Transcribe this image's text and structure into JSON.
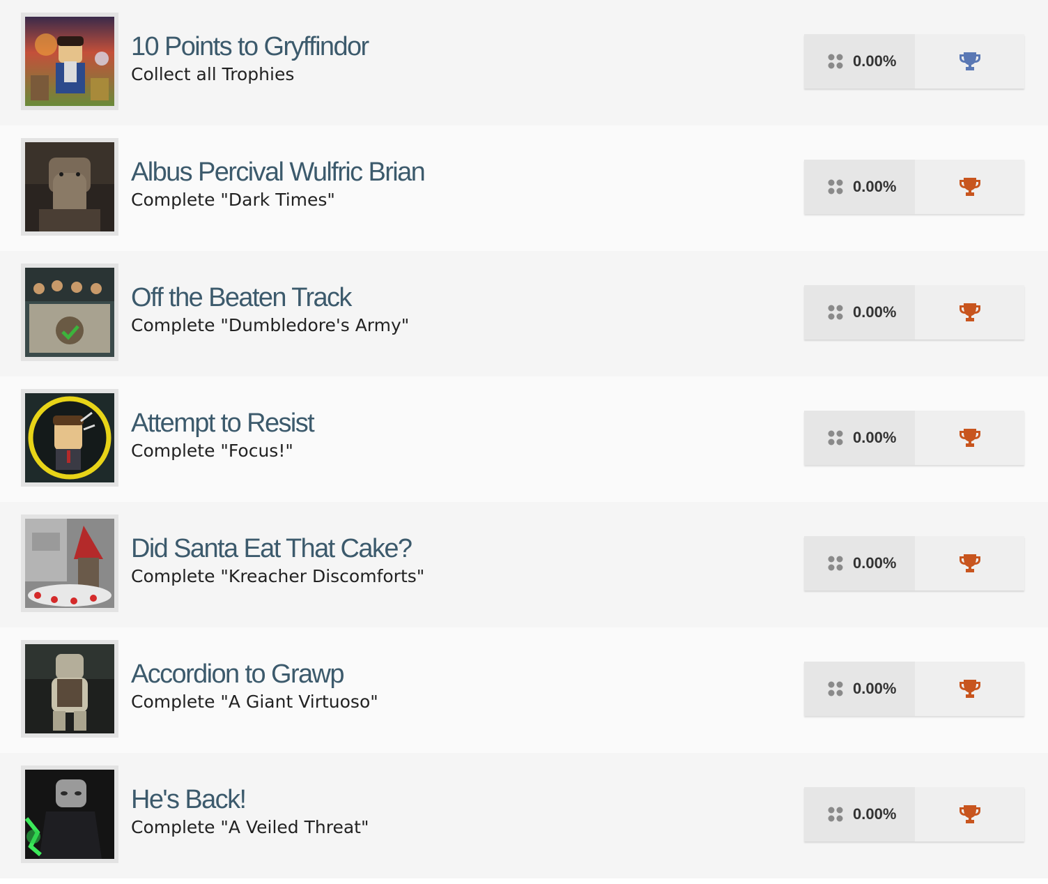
{
  "trophies": [
    {
      "title": "10 Points to Gryffindor",
      "description": "Collect all Trophies",
      "percent": "0.00%",
      "tier": "platinum",
      "trophy_color": "#5a78b4"
    },
    {
      "title": "Albus Percival Wulfric Brian",
      "description": "Complete \"Dark Times\"",
      "percent": "0.00%",
      "tier": "bronze",
      "trophy_color": "#c8551e"
    },
    {
      "title": "Off the Beaten Track",
      "description": "Complete \"Dumbledore's Army\"",
      "percent": "0.00%",
      "tier": "bronze",
      "trophy_color": "#c8551e"
    },
    {
      "title": "Attempt to Resist",
      "description": "Complete \"Focus!\"",
      "percent": "0.00%",
      "tier": "bronze",
      "trophy_color": "#c8551e"
    },
    {
      "title": "Did Santa Eat That Cake?",
      "description": "Complete \"Kreacher Discomforts\"",
      "percent": "0.00%",
      "tier": "bronze",
      "trophy_color": "#c8551e"
    },
    {
      "title": "Accordion to Grawp",
      "description": "Complete \"A Giant Virtuoso\"",
      "percent": "0.00%",
      "tier": "bronze",
      "trophy_color": "#c8551e"
    },
    {
      "title": "He's Back!",
      "description": "Complete \"A Veiled Threat\"",
      "percent": "0.00%",
      "tier": "bronze",
      "trophy_color": "#c8551e"
    }
  ],
  "icons": {
    "rarity": "rarity-dots-icon",
    "trophy": "trophy-icon"
  }
}
